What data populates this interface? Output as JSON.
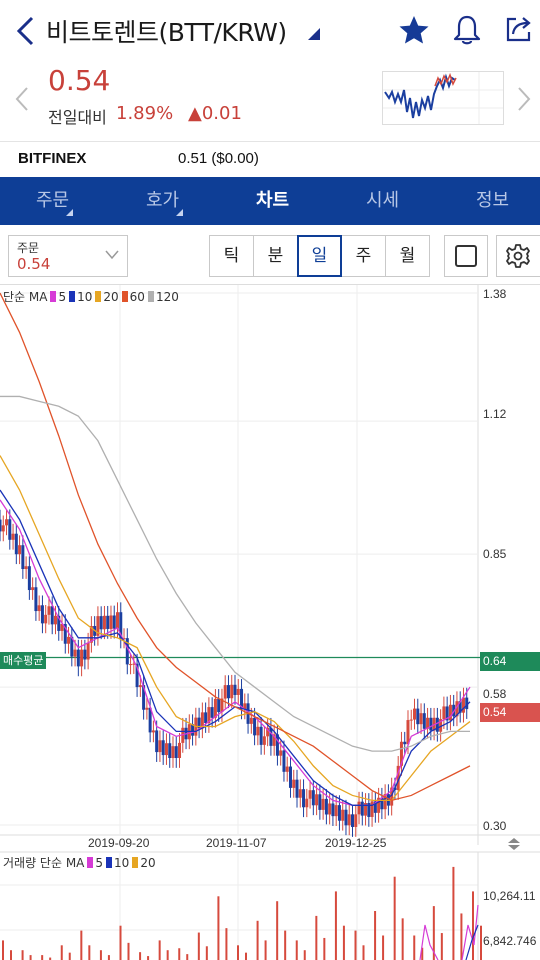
{
  "header": {
    "title": "비트토렌트(BTT/KRW)"
  },
  "quote": {
    "price": "0.54",
    "change_label": "전일대비",
    "change_pct": "1.89%",
    "change_abs": "0.01",
    "change_arrow": "▲",
    "up_color": "#c8413a"
  },
  "exchange": {
    "name": "BITFINEX",
    "price": "0.51 ($0.00)"
  },
  "tabs": [
    {
      "label": "주문",
      "has_menu": true
    },
    {
      "label": "호가",
      "has_menu": true
    },
    {
      "label": "차트",
      "active": true
    },
    {
      "label": "시세"
    },
    {
      "label": "정보"
    }
  ],
  "toolbar": {
    "order_label": "주문",
    "order_value": "0.54",
    "periods": [
      "틱",
      "분",
      "일",
      "주",
      "월"
    ],
    "active_period": "일"
  },
  "chart": {
    "ma_legend_prefix": "단순 MA",
    "ma_periods": [
      "5",
      "10",
      "20",
      "60",
      "120"
    ],
    "ma_colors": [
      "#d63bd6",
      "#1a33b8",
      "#e6a623",
      "#e0532a",
      "#b0b0b0"
    ],
    "y_ticks": [
      "1.38",
      "1.12",
      "0.85",
      "0.58",
      "0.30"
    ],
    "avg_buy_label": "매수평균",
    "avg_buy_value": "0.64",
    "avg_buy_color": "#1e8a5a",
    "current_value": "0.54",
    "current_color": "#d9534f",
    "x_ticks": [
      "2019-09-20",
      "2019-11-07",
      "2019-12-25"
    ],
    "vol_legend_prefix": "거래량 단순 MA",
    "vol_ma_periods": [
      "5",
      "10",
      "20"
    ],
    "vol_ticks": [
      "10,264.11",
      "6,842.746"
    ]
  },
  "chart_data": {
    "type": "line",
    "title": "",
    "xlabel": "",
    "ylabel": "",
    "ylim": [
      0.3,
      1.38
    ],
    "x_ticks": [
      "2019-09-20",
      "2019-11-07",
      "2019-12-25"
    ],
    "y_ticks": [
      1.38,
      1.12,
      0.85,
      0.58,
      0.3
    ],
    "series": [
      {
        "name": "5",
        "color": "#d63bd6",
        "values": [
          0.96,
          0.9,
          0.8,
          0.72,
          0.66,
          0.68,
          0.7,
          0.62,
          0.5,
          0.48,
          0.49,
          0.52,
          0.55,
          0.52,
          0.48,
          0.43,
          0.38,
          0.35,
          0.34,
          0.34,
          0.37,
          0.48,
          0.5,
          0.52,
          0.58
        ]
      },
      {
        "name": "10",
        "color": "#1a33b8",
        "values": [
          0.98,
          0.92,
          0.83,
          0.74,
          0.68,
          0.68,
          0.69,
          0.64,
          0.53,
          0.49,
          0.49,
          0.51,
          0.54,
          0.53,
          0.49,
          0.44,
          0.39,
          0.36,
          0.34,
          0.34,
          0.36,
          0.45,
          0.49,
          0.51,
          0.55
        ]
      },
      {
        "name": "20",
        "color": "#e6a623",
        "values": [
          1.05,
          0.98,
          0.89,
          0.8,
          0.72,
          0.69,
          0.68,
          0.66,
          0.58,
          0.52,
          0.5,
          0.5,
          0.52,
          0.53,
          0.51,
          0.47,
          0.42,
          0.38,
          0.36,
          0.35,
          0.35,
          0.4,
          0.45,
          0.48,
          0.51
        ]
      },
      {
        "name": "60",
        "color": "#e0532a",
        "values": [
          1.38,
          1.3,
          1.2,
          1.09,
          0.97,
          0.87,
          0.79,
          0.72,
          0.66,
          0.62,
          0.59,
          0.56,
          0.54,
          0.52,
          0.5,
          0.48,
          0.46,
          0.43,
          0.4,
          0.37,
          0.35,
          0.36,
          0.38,
          0.4,
          0.42
        ]
      },
      {
        "name": "120",
        "color": "#b0b0b0",
        "values": [
          1.17,
          1.17,
          1.16,
          1.15,
          1.13,
          1.08,
          1.0,
          0.92,
          0.84,
          0.77,
          0.71,
          0.66,
          0.61,
          0.58,
          0.55,
          0.52,
          0.5,
          0.48,
          0.46,
          0.45,
          0.45,
          0.46,
          0.48,
          0.49,
          0.49
        ]
      }
    ],
    "price": {
      "name": "candles",
      "values": [
        0.92,
        0.85,
        0.74,
        0.7,
        0.64,
        0.7,
        0.72,
        0.58,
        0.46,
        0.46,
        0.5,
        0.55,
        0.57,
        0.5,
        0.46,
        0.38,
        0.34,
        0.33,
        0.32,
        0.33,
        0.37,
        0.52,
        0.51,
        0.52,
        0.56
      ]
    },
    "avg_buy": 0.64,
    "current": 0.54
  }
}
